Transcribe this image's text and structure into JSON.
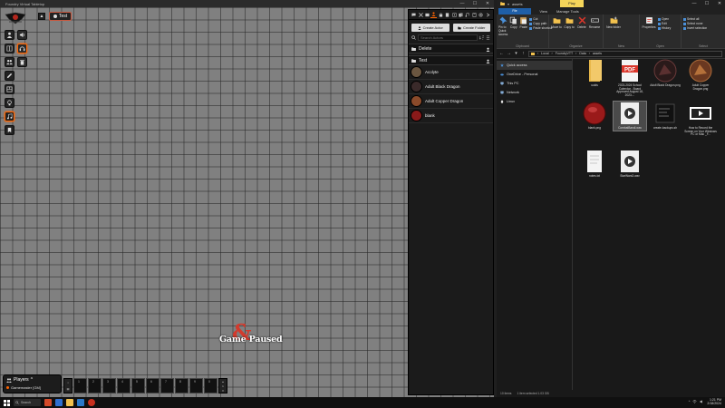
{
  "foundry": {
    "window_title": "Foundry Virtual Tabletop",
    "window_controls": [
      "—",
      "☐",
      "✕"
    ],
    "scene_nav_label": "Test",
    "collapse_label": "▲",
    "controls": [
      "person-icon",
      "volume-icon",
      "book-icon",
      "headphones-icon",
      "people-icon",
      "trash-icon",
      "pencil-icon",
      "square-icon",
      "bulb-icon",
      "music-icon",
      "bookmark-icon"
    ],
    "paused_text": "Game Paused",
    "paused_symbol": "&",
    "players_title": "Players",
    "players_toggle": "^",
    "player_name": "Gamemaster [GM]",
    "hotbar_slots": [
      "1",
      "2",
      "3",
      "4",
      "5",
      "6",
      "7",
      "8",
      "9",
      "0"
    ],
    "hotbar_page": "1"
  },
  "sidebar": {
    "tabs": [
      "chat-icon",
      "combat-icon",
      "scenes-icon",
      "actors-icon",
      "items-icon",
      "journal-icon",
      "tables-icon",
      "cards-icon",
      "playlists-icon",
      "compendium-icon",
      "settings-icon",
      "collapse-icon"
    ],
    "create_actor": "Create Actor",
    "create_folder": "Create Folder",
    "search_placeholder": "Search Actors",
    "folders": [
      "Delete",
      "Test"
    ],
    "actors": [
      "Acolyte",
      "Adult Black Dragon",
      "Adult Copper Dragon",
      "blank"
    ]
  },
  "explorer": {
    "title": "assets",
    "play_tab": "Play",
    "manage_tab": "Manage Tools",
    "window_controls": [
      "—",
      "☐",
      "✕"
    ],
    "menu": [
      "File",
      "Home",
      "Share",
      "View",
      "Manage Tools"
    ],
    "ribbon": {
      "clipboard": {
        "label": "Clipboard",
        "pin": "Pin to Quick access",
        "copy": "Copy",
        "paste": "Paste",
        "cut": "Cut",
        "copy_path": "Copy path",
        "paste_shortcut": "Paste shortcut"
      },
      "organize": {
        "label": "Organize",
        "move": "Move to",
        "copyto": "Copy to",
        "delete": "Delete",
        "rename": "Rename"
      },
      "new": {
        "label": "New",
        "folder": "New folder"
      },
      "open": {
        "label": "Open",
        "properties": "Properties",
        "open": "Open",
        "edit": "Edit",
        "history": "History"
      },
      "select": {
        "label": "Select",
        "all": "Select all",
        "none": "Select none",
        "invert": "Invert selection"
      }
    },
    "address": [
      "Local",
      "FoundryVTT",
      "Data",
      "assets"
    ],
    "nav": [
      "Quick access",
      "OneDrive - Personal",
      "This PC",
      "Network",
      "Linux"
    ],
    "files": [
      {
        "name": "uuids",
        "kind": "folder"
      },
      {
        "name": "2023-2024 School Calendar - Board Approved August 18, 2023....",
        "kind": "pdf"
      },
      {
        "name": "Adult Black Dragon.png",
        "kind": "image"
      },
      {
        "name": "Adult Copper Dragon.png",
        "kind": "image"
      },
      {
        "name": "blank.png",
        "kind": "red"
      },
      {
        "name": "CombatBandi.wav",
        "kind": "video"
      },
      {
        "name": "create-backups.sh",
        "kind": "dark"
      },
      {
        "name": "How to Record the Screen on Your Windows PC or Mac _F...",
        "kind": "video"
      },
      {
        "name": "notes.txt",
        "kind": "text"
      },
      {
        "name": "StarWars3.wav",
        "kind": "video"
      }
    ],
    "status_items": "10 items",
    "status_selected": "1 item selected  1.03 GB"
  },
  "taskbar": {
    "search_label": "Search",
    "time": "1:21 PM",
    "date": "2/18/2024",
    "tray_icons": [
      "chevron-up-icon",
      "wifi-icon",
      "volume-icon"
    ]
  },
  "colors": {
    "accent": "#ff6400",
    "dnd_red": "#d23a2d",
    "explorer_blue": "#1f5fa8",
    "play_yellow": "#f5d55a"
  }
}
